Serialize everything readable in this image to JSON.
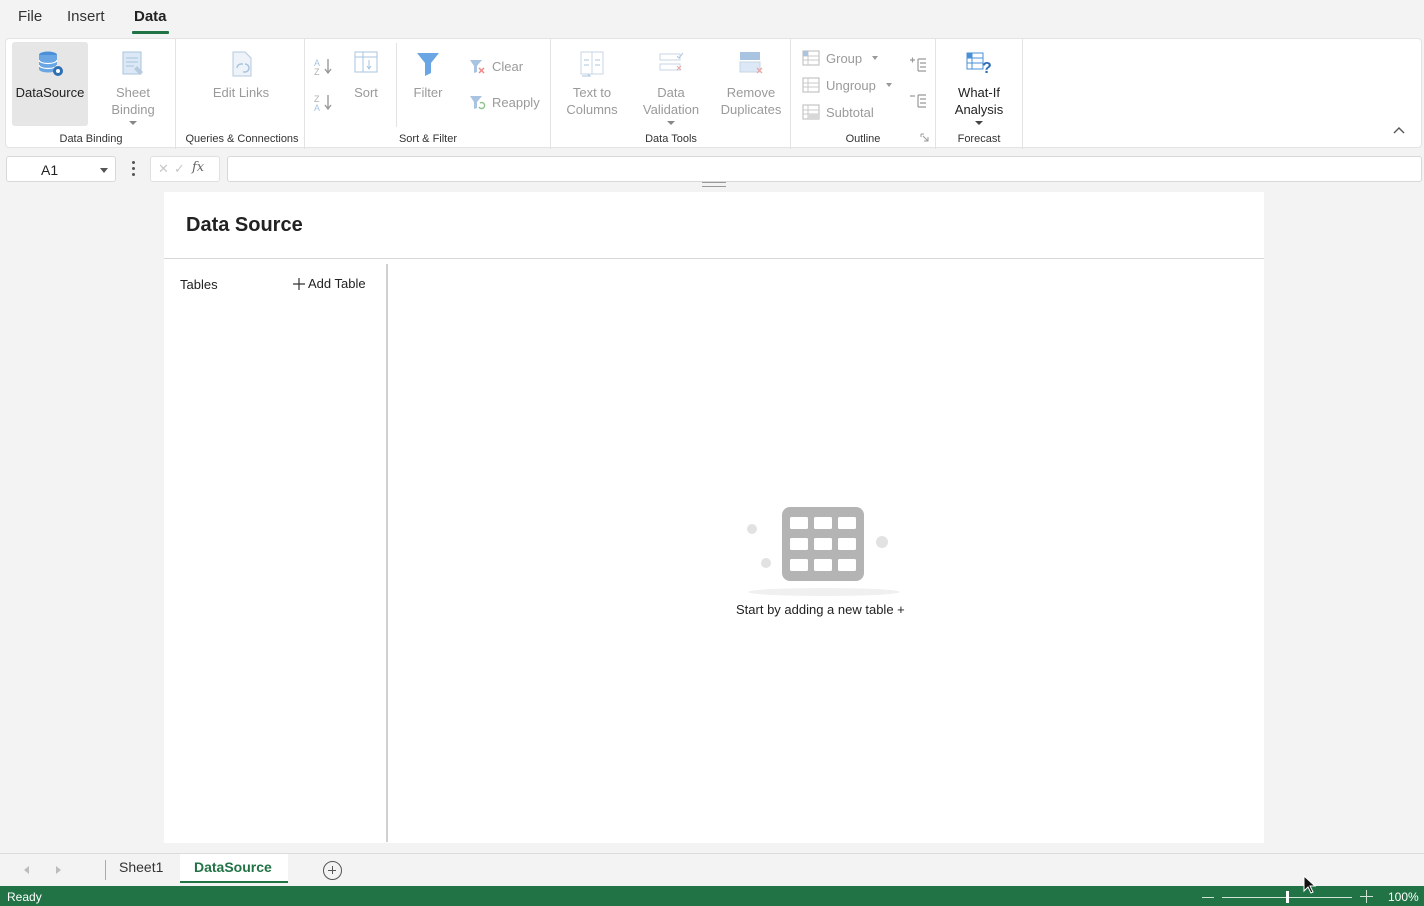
{
  "menu": {
    "tabs": [
      {
        "label": "File"
      },
      {
        "label": "Insert"
      },
      {
        "label": "Data",
        "active": true
      }
    ]
  },
  "ribbon": {
    "data_binding": {
      "group_label": "Data Binding",
      "datasource": {
        "label": "DataSource",
        "selected": true
      },
      "sheet_binding": {
        "label_line1": "Sheet",
        "label_line2": "Binding"
      }
    },
    "queries": {
      "group_label": "Queries & Connections",
      "edit_links": {
        "label": "Edit Links"
      }
    },
    "sort_filter": {
      "group_label": "Sort & Filter",
      "sort": {
        "label": "Sort"
      },
      "filter": {
        "label": "Filter"
      },
      "clear": {
        "label": "Clear"
      },
      "reapply": {
        "label": "Reapply"
      }
    },
    "data_tools": {
      "group_label": "Data Tools",
      "text_to_columns": {
        "label_line1": "Text to",
        "label_line2": "Columns"
      },
      "data_validation": {
        "label_line1": "Data",
        "label_line2": "Validation"
      },
      "remove_duplicates": {
        "label_line1": "Remove",
        "label_line2": "Duplicates"
      }
    },
    "outline": {
      "group_label": "Outline",
      "group": {
        "label": "Group"
      },
      "ungroup": {
        "label": "Ungroup"
      },
      "subtotal": {
        "label": "Subtotal"
      }
    },
    "forecast": {
      "group_label": "Forecast",
      "what_if": {
        "label_line1": "What-If",
        "label_line2": "Analysis"
      }
    }
  },
  "formula_bar": {
    "name_box": "A1",
    "cancel_glyph": "✕",
    "confirm_glyph": "✓",
    "fx_glyph": "fx",
    "formula": ""
  },
  "panel": {
    "title": "Data Source",
    "tables_label": "Tables",
    "add_table": "Add Table",
    "empty_message": "Start by adding a new table +"
  },
  "sheets": {
    "tabs": [
      {
        "label": "Sheet1"
      },
      {
        "label": "DataSource",
        "active": true
      }
    ]
  },
  "status": {
    "ready": "Ready",
    "zoom": "100%",
    "zoom_level": 1.0
  },
  "colors": {
    "accent": "#217346",
    "ribbon_icon_blue": "#4a90d9"
  }
}
